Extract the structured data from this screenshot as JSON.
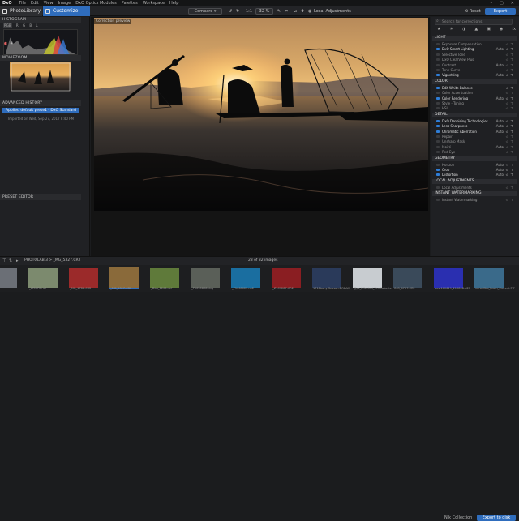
{
  "menubar": {
    "logo": "DxO",
    "items": [
      "File",
      "Edit",
      "View",
      "Image",
      "DxO Optics Modules",
      "Palettes",
      "Workspace",
      "Help"
    ],
    "window_controls": [
      "–",
      "▢",
      "✕"
    ]
  },
  "toolbar": {
    "tab_library": "PhotoLibrary",
    "tab_customize": "Customize",
    "compare": "Compare",
    "zoom_fit": "1:1",
    "zoom_value": "32 %",
    "local_adjustments": "Local Adjustments",
    "reset": "Reset",
    "export": "Export"
  },
  "left_panel": {
    "histogram_title": "HISTOGRAM",
    "histogram_channels": [
      "RGB",
      "R",
      "G",
      "B",
      "L"
    ],
    "moviezoom_title": "MOVIEZOOM",
    "history_title": "ADVANCED HISTORY",
    "history_item": "Applied default preset",
    "history_item_value": "1 - DxO Standard",
    "history_sub": "Imported on Wed, Sep 27, 2017 8:40 PM",
    "preset_editor_title": "PRESET EDITOR"
  },
  "viewer": {
    "correction_label": "Correction preview"
  },
  "right_panel": {
    "search_placeholder": "Search for corrections",
    "sections": [
      {
        "title": "LIGHT",
        "tools": [
          {
            "label": "Exposure Compensation",
            "on": false,
            "auto": ""
          },
          {
            "label": "DxO Smart Lighting",
            "on": true,
            "auto": "Auto"
          },
          {
            "label": "Selective Tone",
            "on": false,
            "auto": ""
          },
          {
            "label": "DxO ClearView Plus",
            "on": false,
            "auto": ""
          },
          {
            "label": "Contrast",
            "on": false,
            "auto": "Auto"
          },
          {
            "label": "Tone Curve",
            "on": false,
            "auto": ""
          },
          {
            "label": "Vignetting",
            "on": true,
            "auto": "Auto"
          }
        ]
      },
      {
        "title": "COLOR",
        "tools": [
          {
            "label": "Edit White Balance",
            "on": true,
            "auto": ""
          },
          {
            "label": "Color Accentuation",
            "on": false,
            "auto": ""
          },
          {
            "label": "Color Rendering",
            "on": true,
            "auto": "Auto"
          },
          {
            "label": "Style - Toning",
            "on": false,
            "auto": ""
          },
          {
            "label": "HSL",
            "on": false,
            "auto": ""
          }
        ]
      },
      {
        "title": "DETAIL",
        "tools": [
          {
            "label": "DxO Denoising Technologies",
            "on": true,
            "auto": "Auto"
          },
          {
            "label": "Lens Sharpness",
            "on": true,
            "auto": "Auto"
          },
          {
            "label": "Chromatic Aberration",
            "on": true,
            "auto": "Auto"
          },
          {
            "label": "Repair",
            "on": false,
            "auto": ""
          },
          {
            "label": "Unsharp Mask",
            "on": false,
            "auto": ""
          },
          {
            "label": "Moiré",
            "on": false,
            "auto": "Auto"
          },
          {
            "label": "Red Eye",
            "on": false,
            "auto": ""
          }
        ]
      },
      {
        "title": "GEOMETRY",
        "tools": [
          {
            "label": "Horizon",
            "on": false,
            "auto": "Auto"
          },
          {
            "label": "Crop",
            "on": true,
            "auto": "Auto"
          },
          {
            "label": "Distortion",
            "on": true,
            "auto": "Auto"
          }
        ]
      },
      {
        "title": "LOCAL ADJUSTMENTS",
        "tools": [
          {
            "label": "Local Adjustments",
            "on": false,
            "auto": ""
          }
        ]
      },
      {
        "title": "INSTANT WATERMARKING",
        "tools": [
          {
            "label": "Instant Watermarking",
            "on": false,
            "auto": ""
          }
        ]
      }
    ]
  },
  "filmstrip": {
    "path": "PHOTOLAB 3 > _MG_5327.CR2",
    "count": "23 of 32 images",
    "nik_collection": "Nik Collection",
    "export_to_disk": "Export to disk",
    "files": [
      {
        "name": "",
        "color": "#6b6f76"
      },
      {
        "name": "_LT5870.nef",
        "color": "#7c8a6e"
      },
      {
        "name": "_MG_1788.CR2",
        "color": "#9b2a2a"
      },
      {
        "name": "_MG_5327.CR2",
        "color": "#8a6a3a"
      },
      {
        "name": "_DLA_1206.nef",
        "color": "#5f7a3a"
      },
      {
        "name": "_P1050838.dng",
        "color": "#5a5f58"
      },
      {
        "name": "_P1060022.rw2",
        "color": "#1a6ea0"
      },
      {
        "name": "_Z7C7287.CR2",
        "color": "#8a1e22"
      },
      {
        "name": "1718bony-Season-DREAM",
        "color": "#2a3a5a"
      },
      {
        "name": "@pz_Effected_Tim Roberts",
        "color": "#c8ccd0"
      },
      {
        "name": "IMG_6757.CR2",
        "color": "#3a4a5a"
      },
      {
        "name": "pas-160629_213808.NEF",
        "color": "#2a2fb0"
      },
      {
        "name": "versailles_basin_Current.TIF",
        "color": "#3a6a8a"
      }
    ]
  },
  "colors": {
    "accent": "#2f6dbd",
    "panel": "#1f2023",
    "viewer_bg": "#141414"
  }
}
